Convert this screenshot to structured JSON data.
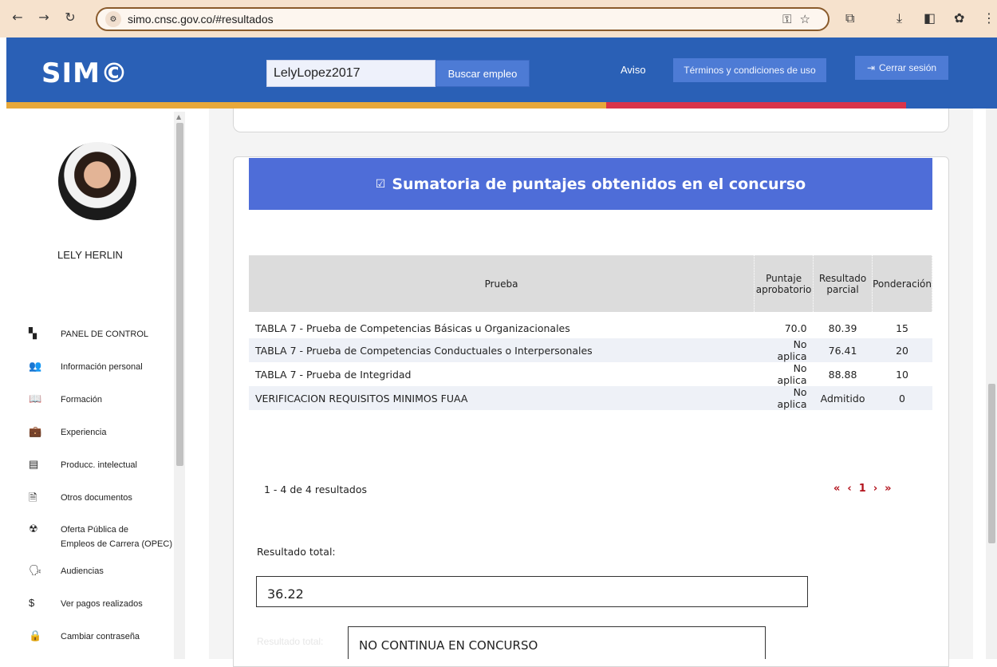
{
  "browser": {
    "url": "simo.cnsc.gov.co/#resultados",
    "back_icon": "arrow-left",
    "forward_icon": "arrow-right",
    "reload_icon": "reload"
  },
  "header": {
    "logo": "SIM©",
    "search_value": "LelyLopez2017",
    "search_button": "Buscar empleo",
    "aviso": "Aviso",
    "terms": "Términos y condiciones de uso",
    "logout": "Cerrar sesión",
    "colors": {
      "primary": "#2a60b6",
      "stripe_yellow": "#e7a83a",
      "stripe_red": "#d9344a"
    }
  },
  "sidebar": {
    "user_name": "LELY HERLIN",
    "items": [
      {
        "label": "PANEL DE CONTROL",
        "icon": "dashboard-icon"
      },
      {
        "label": "Información personal",
        "icon": "people-icon"
      },
      {
        "label": "Formación",
        "icon": "reading-icon"
      },
      {
        "label": "Experiencia",
        "icon": "briefcase-icon"
      },
      {
        "label": "Producc. intelectual",
        "icon": "publication-icon"
      },
      {
        "label": "Otros documentos",
        "icon": "document-icon"
      },
      {
        "label": "Oferta Pública de",
        "label2": "Empleos de Carrera (OPEC)",
        "icon": "radiation-icon"
      },
      {
        "label": "Audiencias",
        "icon": "speaker-icon"
      },
      {
        "label": "Ver pagos realizados",
        "icon": "dollar-icon"
      },
      {
        "label": "Cambiar contraseña",
        "icon": "lock-icon"
      }
    ]
  },
  "main": {
    "panel_title": "Sumatoria de puntajes obtenidos en el concurso",
    "table": {
      "headers": [
        "Prueba",
        "Puntaje aprobatorio",
        "Resultado parcial",
        "Ponderación"
      ],
      "rows": [
        [
          "TABLA 7 - Prueba de Competencias Básicas u Organizacionales",
          "70.0",
          "80.39",
          "15"
        ],
        [
          "TABLA 7 - Prueba de Competencias Conductuales o Interpersonales",
          "No aplica",
          "76.41",
          "20"
        ],
        [
          "TABLA 7 - Prueba de Integridad",
          "No aplica",
          "88.88",
          "10"
        ],
        [
          "VERIFICACION REQUISITOS MINIMOS FUAA",
          "No aplica",
          "Admitido",
          "0"
        ]
      ]
    },
    "pagination": {
      "info": "1 - 4 de 4 resultados",
      "first": "«",
      "prev": "‹",
      "page": "1",
      "next": "›",
      "last": "»"
    },
    "total_label": "Resultado total:",
    "total_value": "36.22",
    "faded_label": "Resultado total:",
    "status_value": "NO CONTINUA EN CONCURSO"
  }
}
